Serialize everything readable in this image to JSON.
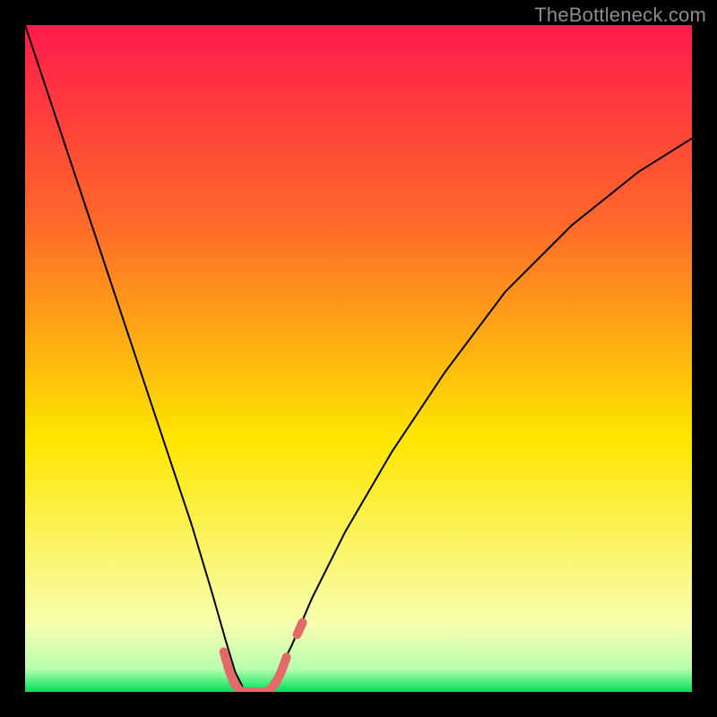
{
  "watermark": "TheBottleneck.com",
  "chart_data": {
    "type": "line",
    "title": "",
    "xlabel": "",
    "ylabel": "",
    "xlim": [
      0,
      100
    ],
    "ylim": [
      0,
      100
    ],
    "grid": false,
    "legend": false,
    "gradient": {
      "top": "#ff1a4b",
      "mid": "#ffe600",
      "bottom": "#00e05a"
    },
    "series": [
      {
        "name": "bottleneck-curve",
        "x": [
          0,
          5,
          10,
          15,
          20,
          25,
          28,
          30,
          31.5,
          33,
          34.5,
          36,
          38,
          40,
          43,
          48,
          55,
          63,
          72,
          82,
          92,
          100
        ],
        "y": [
          100,
          85,
          70,
          55,
          40,
          25,
          15,
          8,
          3,
          0,
          0,
          0,
          3,
          7,
          14,
          24,
          36,
          48,
          60,
          70,
          78,
          83
        ],
        "color": "#000000",
        "stroke_width": 2
      },
      {
        "name": "optimal-marker-left",
        "x": [
          29.8,
          30.6,
          31.4,
          32.2,
          33.0
        ],
        "y": [
          6.0,
          3.2,
          1.2,
          0.2,
          0.0
        ],
        "color": "#e46a6a",
        "stroke_width": 10,
        "linecap": "round"
      },
      {
        "name": "optimal-marker-bottom",
        "x": [
          33.0,
          34.0,
          35.0,
          36.0
        ],
        "y": [
          0.0,
          0.0,
          0.0,
          0.0
        ],
        "color": "#e46a6a",
        "stroke_width": 10,
        "linecap": "round"
      },
      {
        "name": "optimal-marker-right",
        "x": [
          36.0,
          36.8,
          37.6,
          38.4,
          39.2
        ],
        "y": [
          0.0,
          0.4,
          1.4,
          3.0,
          5.2
        ],
        "color": "#e46a6a",
        "stroke_width": 10,
        "linecap": "round"
      },
      {
        "name": "optimal-marker-dot",
        "x": [
          40.8,
          41.6
        ],
        "y": [
          8.6,
          10.4
        ],
        "color": "#e46a6a",
        "stroke_width": 10,
        "linecap": "round"
      }
    ]
  }
}
